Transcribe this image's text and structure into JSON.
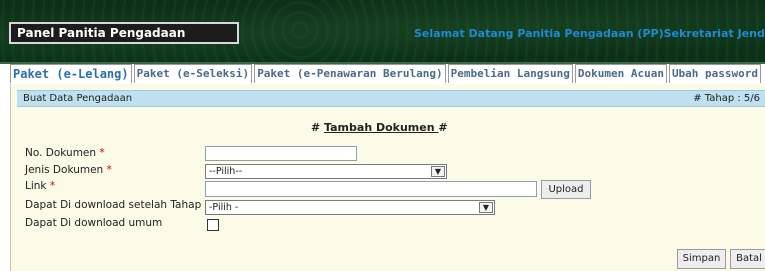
{
  "header": {
    "panel_title": "Panel Panitia Pengadaan",
    "welcome_text": "Selamat Datang Panitia Pengadaan (PP)Sekretariat Jender"
  },
  "tabs": [
    {
      "label": "Paket (e-Lelang)",
      "active": true
    },
    {
      "label": "Paket (e-Seleksi)",
      "active": false
    },
    {
      "label": "Paket (e-Penawaran Berulang)",
      "active": false
    },
    {
      "label": "Pembelian Langsung",
      "active": false
    },
    {
      "label": "Dokumen Acuan",
      "active": false
    },
    {
      "label": "Ubah password",
      "active": false
    }
  ],
  "titlebar": {
    "title": "Buat Data Pengadaan",
    "step": "# Tahap : 5/6"
  },
  "form": {
    "heading_prefix": "# ",
    "heading": "Tambah Dokumen ",
    "heading_suffix": "#",
    "no_dokumen_label": "No. Dokumen ",
    "no_dokumen_value": "",
    "jenis_dokumen_label": "Jenis Dokumen ",
    "jenis_dokumen_value": "--Pilih--",
    "link_label": "Link ",
    "link_value": "",
    "download_tahap_label": "Dapat Di download setelah Tahap",
    "download_tahap_value": "-Pilih -",
    "download_umum_label": "Dapat Di download umum",
    "download_umum_checked": false,
    "required_mark": "*",
    "upload_button": "Upload",
    "simpan_button": "Simpan",
    "batal_button": "Batal"
  },
  "colors": {
    "header_bg": "#0a2a14",
    "welcome": "#1e8ad0",
    "tab_text": "#2a6fae",
    "titlebar_bg": "#bfe0ee",
    "panel_bg": "#fbfbe8",
    "required": "#cc0000"
  }
}
